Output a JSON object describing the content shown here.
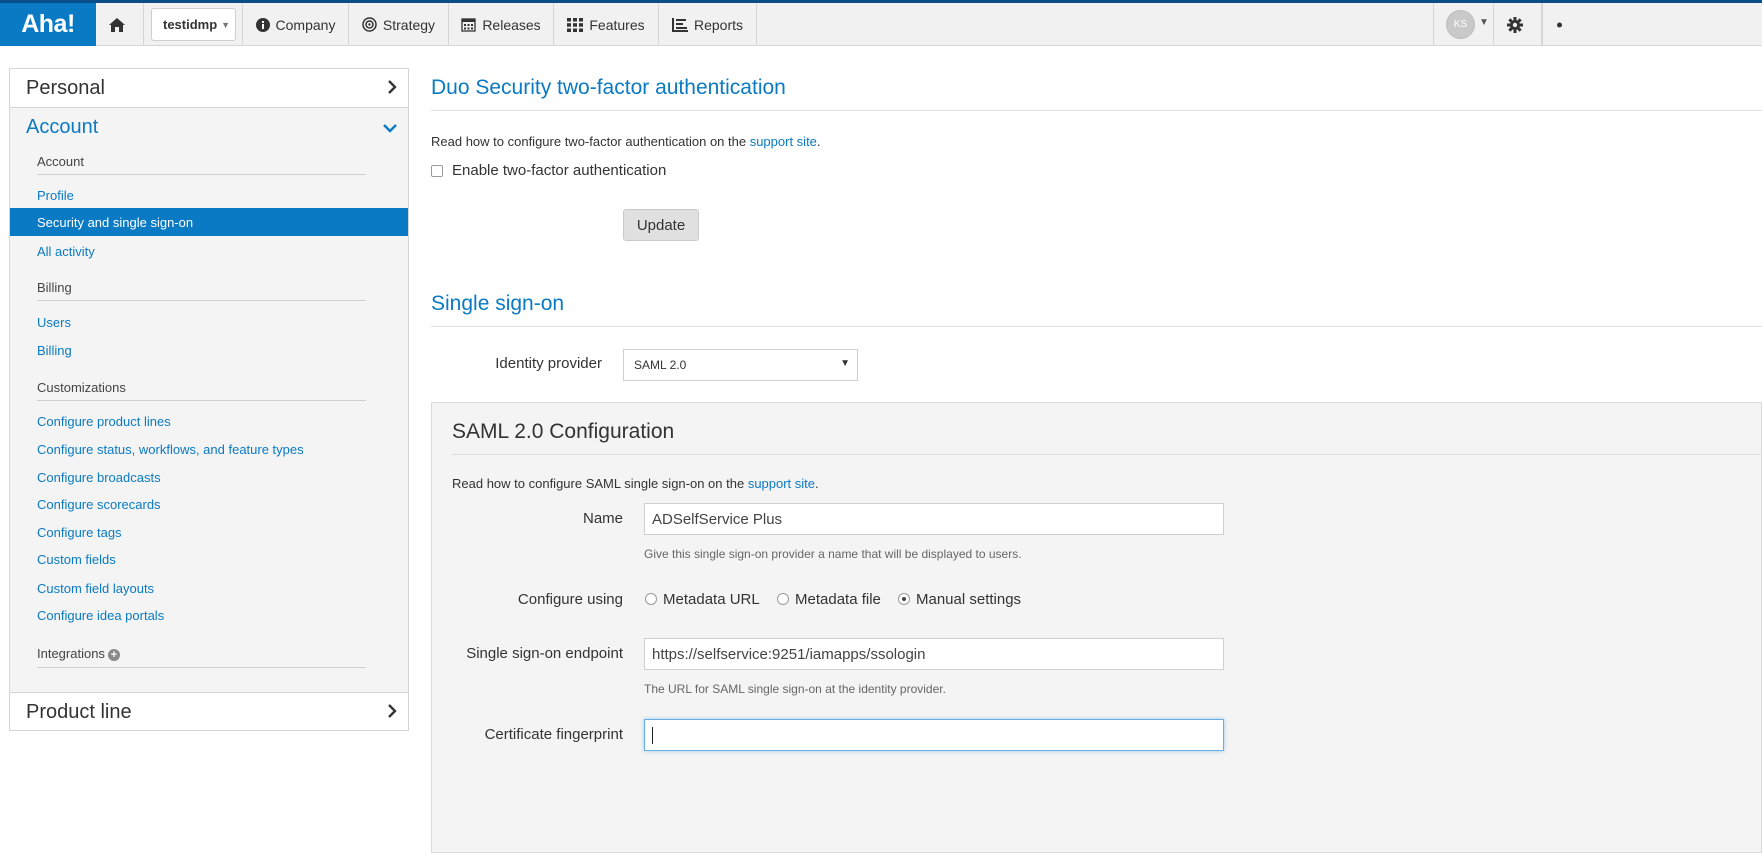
{
  "nav": {
    "logo": "Aha!",
    "workspace": "testidmp",
    "items": [
      {
        "label": "Company",
        "icon": "info-circle-icon"
      },
      {
        "label": "Strategy",
        "icon": "target-icon"
      },
      {
        "label": "Releases",
        "icon": "calendar-icon"
      },
      {
        "label": "Features",
        "icon": "grid-icon"
      },
      {
        "label": "Reports",
        "icon": "report-icon"
      }
    ],
    "avatar_initials": "KS"
  },
  "sidebar": {
    "personal": "Personal",
    "account": "Account",
    "product_line": "Product line",
    "sections": [
      {
        "label": "Account",
        "links": [
          "Profile",
          "Security and single sign-on",
          "All activity"
        ]
      },
      {
        "label": "Billing",
        "links": [
          "Users",
          "Billing"
        ]
      },
      {
        "label": "Customizations",
        "links": [
          "Configure product lines",
          "Configure status, workflows, and feature types",
          "Configure broadcasts",
          "Configure scorecards",
          "Configure tags",
          "Custom fields",
          "Custom field layouts",
          "Configure idea portals"
        ]
      },
      {
        "label": "Integrations",
        "links": []
      }
    ],
    "active": "Security and single sign-on"
  },
  "duo": {
    "title": "Duo Security two-factor authentication",
    "help_prefix": "Read how to configure two-factor authentication on the ",
    "help_link": "support site",
    "help_suffix": ".",
    "checkbox_label": "Enable two-factor authentication",
    "checkbox_checked": false,
    "update_button": "Update"
  },
  "sso": {
    "title": "Single sign-on",
    "identity_provider_label": "Identity provider",
    "identity_provider_value": "SAML 2.0"
  },
  "saml": {
    "title": "SAML 2.0 Configuration",
    "help_prefix": "Read how to configure SAML single sign-on on the ",
    "help_link": "support site",
    "help_suffix": ".",
    "name_label": "Name",
    "name_value": "ADSelfService Plus",
    "name_help": "Give this single sign-on provider a name that will be displayed to users.",
    "configure_label": "Configure using",
    "configure_options": [
      "Metadata URL",
      "Metadata file",
      "Manual settings"
    ],
    "configure_selected": "Manual settings",
    "endpoint_label": "Single sign-on endpoint",
    "endpoint_value": "https://selfservice:9251/iamapps/ssologin",
    "endpoint_help": "The URL for SAML single sign-on at the identity provider.",
    "fingerprint_label": "Certificate fingerprint",
    "fingerprint_value": ""
  }
}
